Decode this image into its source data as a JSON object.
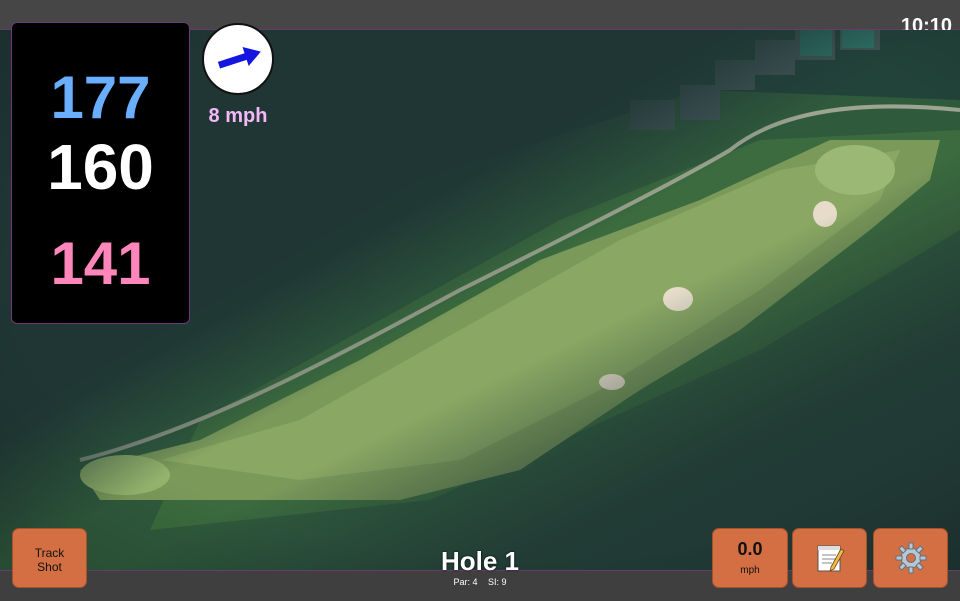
{
  "status_bar": {
    "time": "10:10"
  },
  "yardages": {
    "back": "177",
    "middle": "160",
    "front": "141"
  },
  "wind": {
    "speed": "8 mph",
    "direction_icon": "wind-arrow-icon"
  },
  "hole": {
    "title": "Hole 1",
    "par_label": "Par: 4",
    "si_label": "SI: 9"
  },
  "buttons": {
    "track_shot_line1": "Track",
    "track_shot_line2": "Shot",
    "speed_value": "0.0",
    "speed_unit": "mph",
    "notes_icon": "notepad-icon",
    "settings_icon": "gear-icon"
  },
  "colors": {
    "back_yardage": "#6aaeff",
    "middle_yardage": "#ffffff",
    "front_yardage": "#ff86bb",
    "button_orange": "#d36f43",
    "wind_speed_text": "#f5b8f7"
  }
}
